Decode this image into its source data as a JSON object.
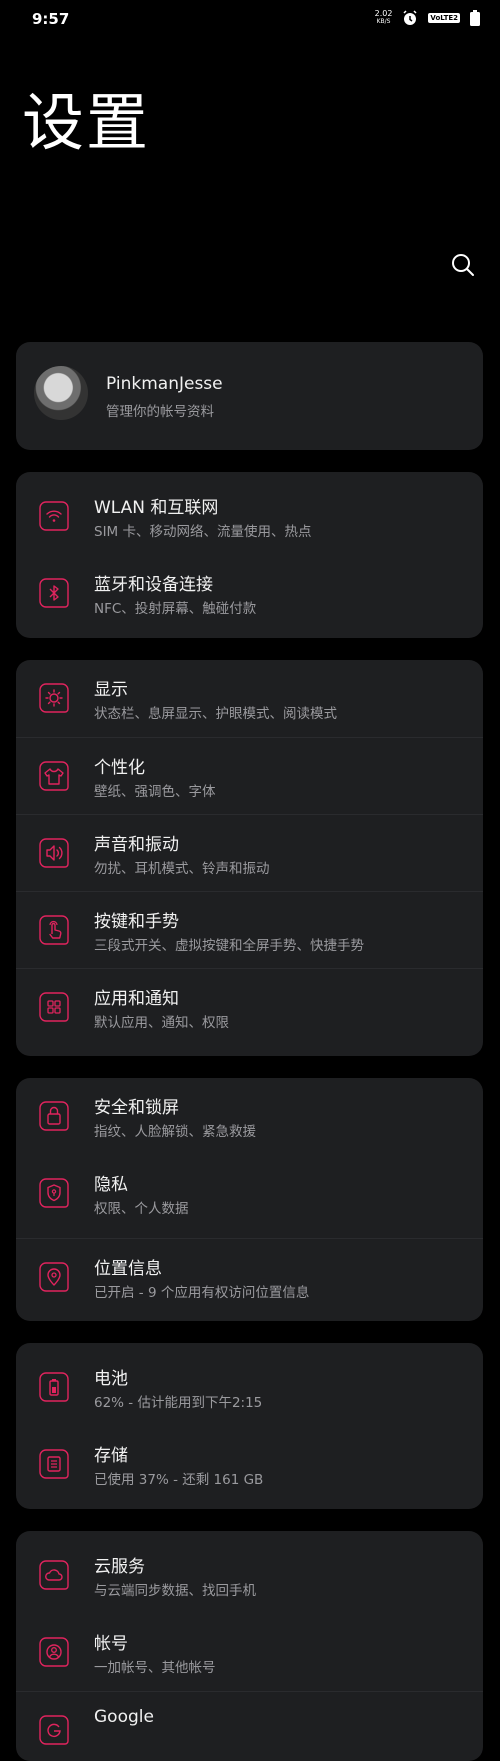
{
  "status_bar": {
    "time": "9:57",
    "net_speed_value": "2.02",
    "net_speed_unit": "KB/S",
    "volte_label": "VoLTE2"
  },
  "header": {
    "title": "设置"
  },
  "profile": {
    "name": "PinkmanJesse",
    "subtitle": "管理你的帐号资料"
  },
  "icons_color": "#e0245e",
  "cards": [
    {
      "items": [
        {
          "icon": "wifi-icon",
          "title": "WLAN 和互联网",
          "subtitle": "SIM 卡、移动网络、流量使用、热点"
        },
        {
          "icon": "bluetooth-icon",
          "title": "蓝牙和设备连接",
          "subtitle": "NFC、投射屏幕、触碰付款"
        }
      ]
    },
    {
      "items": [
        {
          "icon": "brightness-icon",
          "title": "显示",
          "subtitle": "状态栏、息屏显示、护眼模式、阅读模式"
        },
        {
          "icon": "tshirt-icon",
          "title": "个性化",
          "subtitle": "壁纸、强调色、字体"
        },
        {
          "icon": "speaker-icon",
          "title": "声音和振动",
          "subtitle": "勿扰、耳机模式、铃声和振动"
        },
        {
          "icon": "gesture-hand-icon",
          "title": "按键和手势",
          "subtitle": "三段式开关、虚拟按键和全屏手势、快捷手势"
        },
        {
          "icon": "apps-grid-icon",
          "title": "应用和通知",
          "subtitle": "默认应用、通知、权限"
        }
      ]
    },
    {
      "items": [
        {
          "icon": "lock-icon",
          "title": "安全和锁屏",
          "subtitle": "指纹、人脸解锁、紧急救援"
        },
        {
          "icon": "privacy-shield-icon",
          "title": "隐私",
          "subtitle": "权限、个人数据"
        },
        {
          "icon": "location-pin-icon",
          "title": "位置信息",
          "subtitle": "已开启 - 9 个应用有权访问位置信息"
        }
      ]
    },
    {
      "items": [
        {
          "icon": "battery-icon",
          "title": "电池",
          "subtitle": "62% - 估计能用到下午2:15"
        },
        {
          "icon": "storage-icon",
          "title": "存储",
          "subtitle": "已使用 37% - 还剩 161 GB"
        }
      ]
    },
    {
      "items": [
        {
          "icon": "cloud-icon",
          "title": "云服务",
          "subtitle": "与云端同步数据、找回手机"
        },
        {
          "icon": "account-icon",
          "title": "帐号",
          "subtitle": "一加帐号、其他帐号"
        },
        {
          "icon": "google-icon",
          "title": "Google",
          "subtitle": ""
        }
      ]
    }
  ]
}
